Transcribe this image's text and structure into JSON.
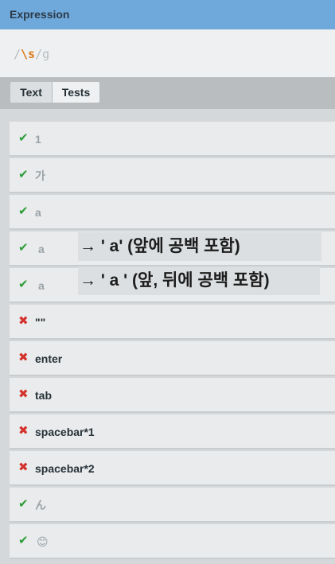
{
  "header": {
    "title": "Expression"
  },
  "expression": {
    "slash_open": "/",
    "body": "\\s",
    "slash_close": "/",
    "flags": "g"
  },
  "tabs": [
    {
      "label": "Text"
    },
    {
      "label": "Tests"
    }
  ],
  "tests": [
    {
      "status": "pass",
      "value": "1"
    },
    {
      "status": "pass",
      "value": "가"
    },
    {
      "status": "pass",
      "value": "a"
    },
    {
      "status": "pass",
      "value": "a"
    },
    {
      "status": "pass",
      "value": "a"
    },
    {
      "status": "fail",
      "value": "\"\""
    },
    {
      "status": "fail",
      "value": "enter"
    },
    {
      "status": "fail",
      "value": "tab"
    },
    {
      "status": "fail",
      "value": "spacebar*1"
    },
    {
      "status": "fail",
      "value": "spacebar*2"
    },
    {
      "status": "pass",
      "value": "ん"
    },
    {
      "status": "pass",
      "value": "😊"
    }
  ],
  "annotations": [
    {
      "text": "→ ' a'  (앞에 공백 포함)"
    },
    {
      "text": "→ ' a ' (앞, 뒤에 공백 포함)"
    }
  ],
  "icons": {
    "pass": "check-icon",
    "fail": "cross-icon"
  },
  "colors": {
    "header": "#6fa9dc",
    "pass": "#2e9d3a",
    "fail": "#d4322c",
    "regex_body": "#dc7c1a"
  }
}
